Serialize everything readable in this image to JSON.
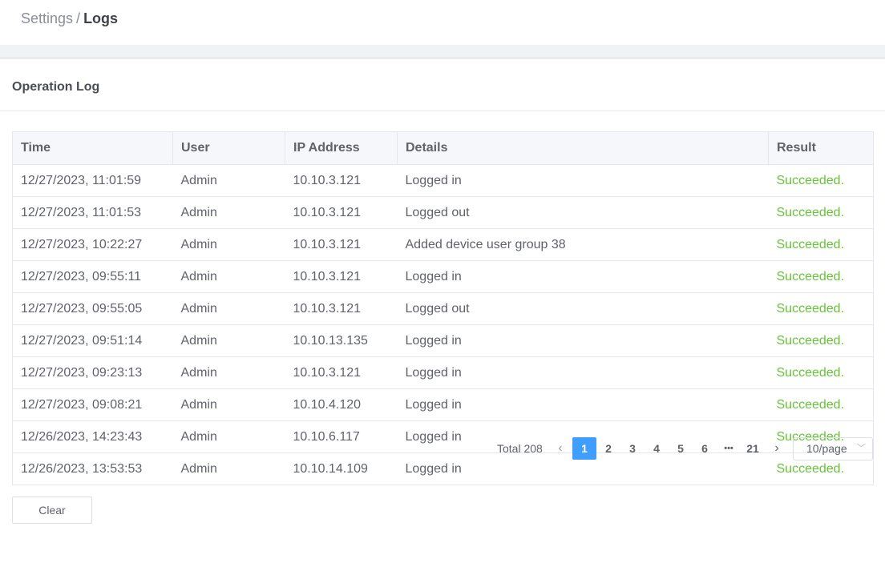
{
  "breadcrumb": {
    "parent": "Settings",
    "separator": "/",
    "current": "Logs"
  },
  "card": {
    "title": "Operation Log"
  },
  "table": {
    "headers": [
      "Time",
      "User",
      "IP Address",
      "Details",
      "Result"
    ],
    "rows": [
      [
        "12/27/2023, 11:01:59",
        "Admin",
        "10.10.3.121",
        "Logged in",
        "Succeeded."
      ],
      [
        "12/27/2023, 11:01:53",
        "Admin",
        "10.10.3.121",
        "Logged out",
        "Succeeded."
      ],
      [
        "12/27/2023, 10:22:27",
        "Admin",
        "10.10.3.121",
        "Added device user group 38",
        "Succeeded."
      ],
      [
        "12/27/2023, 09:55:11",
        "Admin",
        "10.10.3.121",
        "Logged in",
        "Succeeded."
      ],
      [
        "12/27/2023, 09:55:05",
        "Admin",
        "10.10.3.121",
        "Logged out",
        "Succeeded."
      ],
      [
        "12/27/2023, 09:51:14",
        "Admin",
        "10.10.13.135",
        "Logged in",
        "Succeeded."
      ],
      [
        "12/27/2023, 09:23:13",
        "Admin",
        "10.10.3.121",
        "Logged in",
        "Succeeded."
      ],
      [
        "12/27/2023, 09:08:21",
        "Admin",
        "10.10.4.120",
        "Logged in",
        "Succeeded."
      ],
      [
        "12/26/2023, 14:23:43",
        "Admin",
        "10.10.6.117",
        "Logged in",
        "Succeeded."
      ],
      [
        "12/26/2023, 13:53:53",
        "Admin",
        "10.10.14.109",
        "Logged in",
        "Succeeded."
      ]
    ]
  },
  "actions": {
    "clear_label": "Clear"
  },
  "pagination": {
    "total_label": "Total 208",
    "pages": [
      "1",
      "2",
      "3",
      "4",
      "5",
      "6",
      "•••",
      "21"
    ],
    "active_page": "1",
    "page_size": "10/page"
  },
  "colors": {
    "accent": "#409eff",
    "success": "#67c23a"
  }
}
